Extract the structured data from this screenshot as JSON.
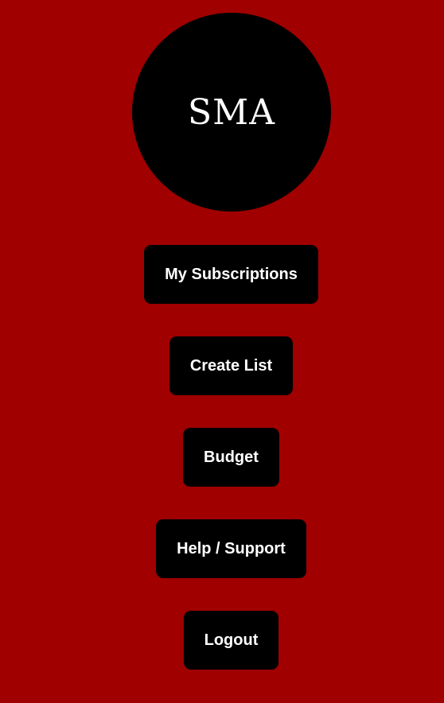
{
  "brand": {
    "logo_text": "SMA"
  },
  "nav": {
    "my_subscriptions": "My Subscriptions",
    "create_list": "Create List",
    "budget": "Budget",
    "help_support": "Help / Support",
    "logout": "Logout"
  },
  "colors": {
    "background": "#a00000",
    "button_bg": "#000000",
    "text": "#ffffff"
  }
}
